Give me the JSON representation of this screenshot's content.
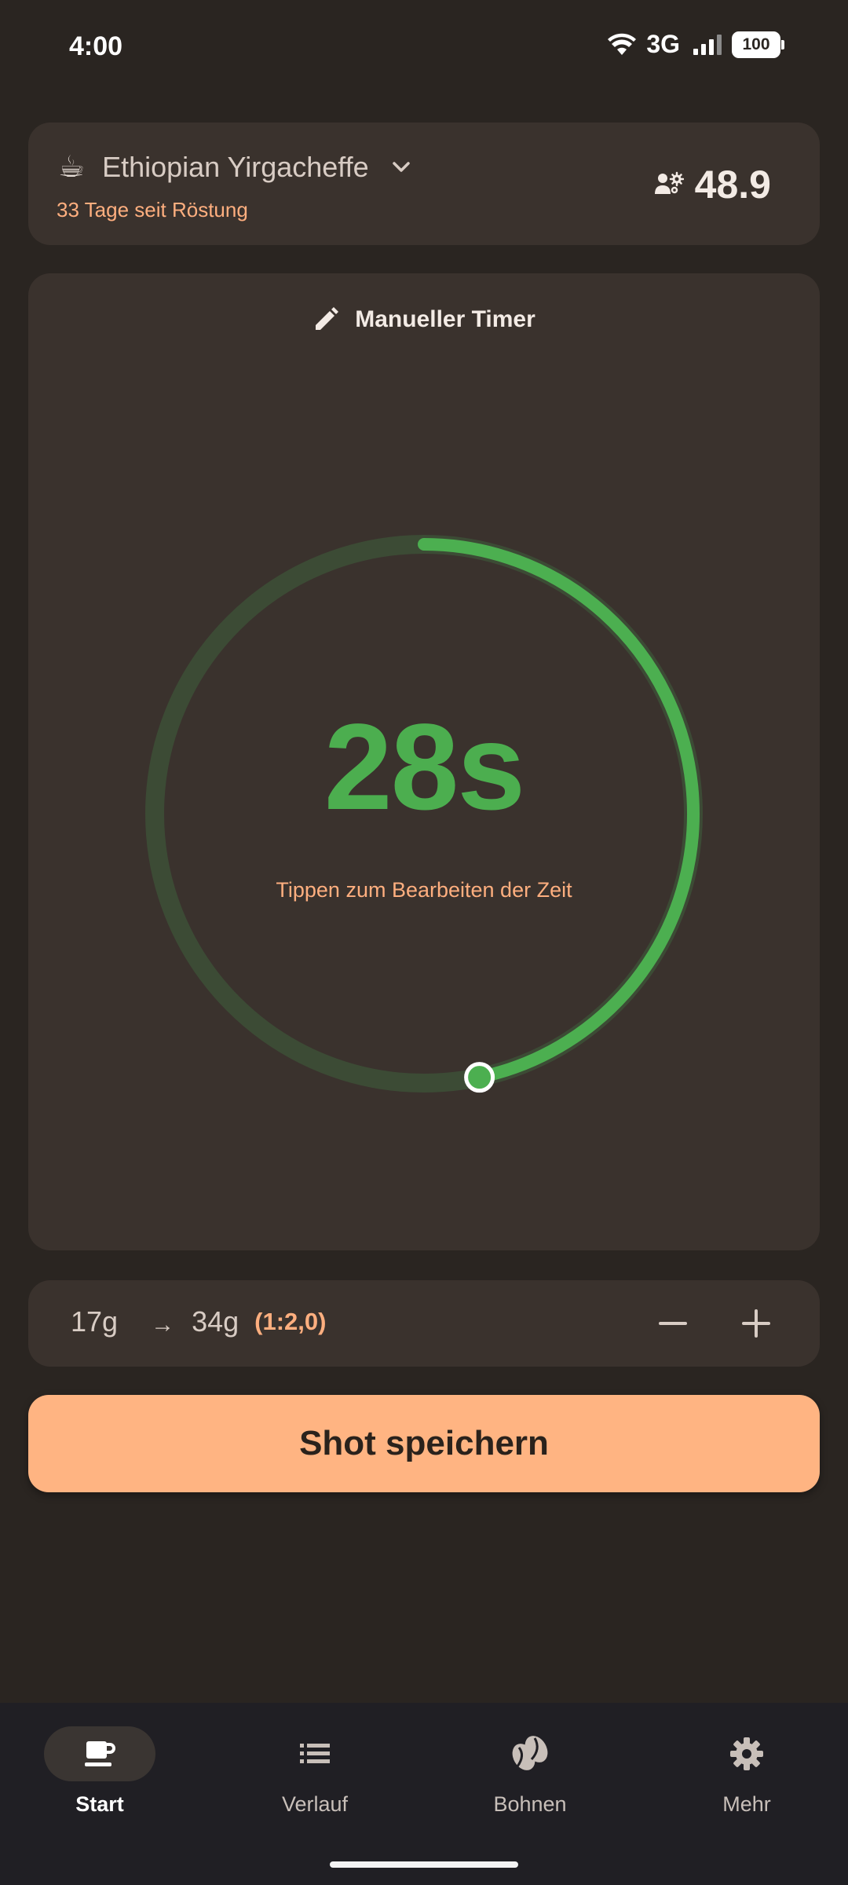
{
  "status_bar": {
    "time": "4:00",
    "network": "3G",
    "battery": "100"
  },
  "bean": {
    "emoji": "☕",
    "name": "Ethiopian Yirgacheffe",
    "days_since_roast": "33 Tage seit Röstung",
    "grinder_setting": "48.9"
  },
  "timer": {
    "mode_label": "Manueller Timer",
    "time": "28s",
    "hint": "Tippen zum Bearbeiten der Zeit",
    "progress_fraction": 0.467,
    "track_color": "#3c4b35",
    "progress_color": "#4caf50"
  },
  "ratio": {
    "dose_in": "17g",
    "arrow": "→",
    "dose_out": "34g",
    "ratio": "(1:2,0)"
  },
  "save_button": {
    "label": "Shot speichern"
  },
  "nav": {
    "items": [
      {
        "label": "Start",
        "icon": "coffee-cup-icon",
        "active": true
      },
      {
        "label": "Verlauf",
        "icon": "list-icon",
        "active": false
      },
      {
        "label": "Bohnen",
        "icon": "coffee-bean-icon",
        "active": false
      },
      {
        "label": "Mehr",
        "icon": "gear-icon",
        "active": false
      }
    ]
  },
  "colors": {
    "background": "#2a2521",
    "card": "#3a322d",
    "accent": "#ffb482",
    "green": "#4cae4f"
  }
}
